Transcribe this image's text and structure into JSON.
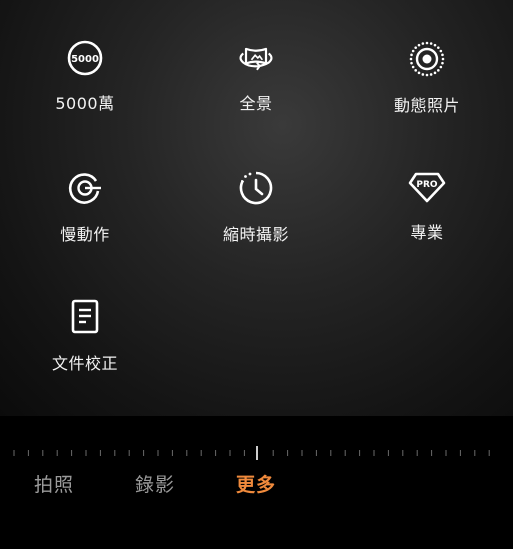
{
  "modes": [
    {
      "label": "5000萬",
      "icon": "5000-badge-icon",
      "badge_text": "5000"
    },
    {
      "label": "全景",
      "icon": "panorama-icon"
    },
    {
      "label": "動態照片",
      "icon": "live-photo-icon"
    },
    {
      "label": "慢動作",
      "icon": "slow-motion-icon"
    },
    {
      "label": "縮時攝影",
      "icon": "timelapse-icon"
    },
    {
      "label": "專業",
      "icon": "pro-badge-icon",
      "badge_text": "PRO"
    },
    {
      "label": "文件校正",
      "icon": "document-icon"
    }
  ],
  "tabs": [
    {
      "label": "拍照",
      "active": false
    },
    {
      "label": "錄影",
      "active": false
    },
    {
      "label": "更多",
      "active": true
    }
  ],
  "colors": {
    "accent": "#f08a3c",
    "tab_inactive": "#9a9a9a",
    "label": "#f2f2f2"
  }
}
